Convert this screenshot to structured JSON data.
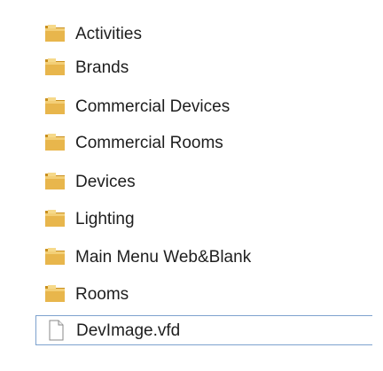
{
  "items": [
    {
      "label": "Activities",
      "type": "folder",
      "icon": "folder-icon",
      "selected": false
    },
    {
      "label": "Brands",
      "type": "folder",
      "icon": "folder-icon",
      "selected": false
    },
    {
      "label": "Commercial Devices",
      "type": "folder",
      "icon": "folder-icon",
      "selected": false
    },
    {
      "label": "Commercial Rooms",
      "type": "folder",
      "icon": "folder-icon",
      "selected": false
    },
    {
      "label": "Devices",
      "type": "folder",
      "icon": "folder-icon",
      "selected": false
    },
    {
      "label": "Lighting",
      "type": "folder",
      "icon": "folder-icon",
      "selected": false
    },
    {
      "label": "Main Menu Web&Blank",
      "type": "folder",
      "icon": "folder-icon",
      "selected": false
    },
    {
      "label": "Rooms",
      "type": "folder",
      "icon": "folder-icon",
      "selected": false
    },
    {
      "label": "DevImage.vfd",
      "type": "file",
      "icon": "document-icon",
      "selected": true
    }
  ],
  "colors": {
    "folder_body": "#e8b64c",
    "folder_light": "#f6d98a",
    "folder_dark": "#c98f1d",
    "selection_border": "#7da2ce"
  }
}
